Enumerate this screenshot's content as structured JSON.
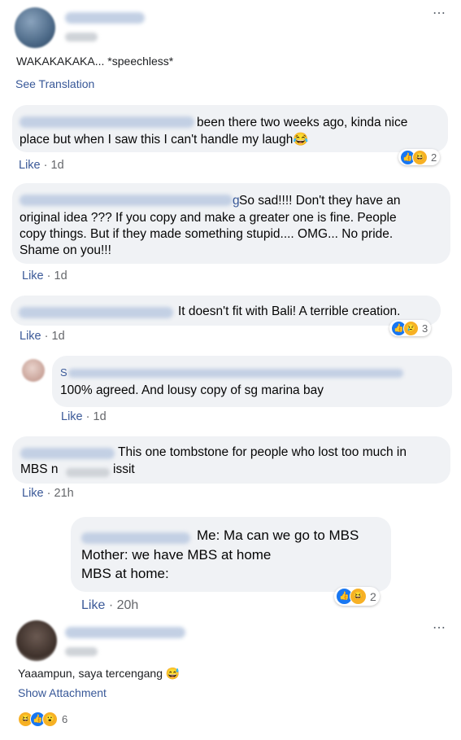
{
  "post1": {
    "text": "WAKAKAKAKA... *speechless*",
    "see_translation": "See Translation",
    "more_icon": "⋯"
  },
  "comments": [
    {
      "text": "been there two weeks ago, kinda nice place but when I saw this I can't handle my laugh😂",
      "line1": "been there two weeks ago, kinda nice",
      "line2": "place but when I saw this I can't handle my laugh😂",
      "like": "Like",
      "time": "1d",
      "reactions": "2"
    },
    {
      "name_tail": "g",
      "line1": " So sad!!!! Don't they have an",
      "line2": "original idea ??? If you copy and make a greater one is fine. People",
      "line3": "copy things. But if they made something stupid.... OMG... No pride.",
      "line4": "Shame on you!!!",
      "like": "Like",
      "time": "1d"
    },
    {
      "line1": "It doesn't fit with Bali! A terrible creation.",
      "like": "Like",
      "time": "1d",
      "reactions": "3"
    },
    {
      "name_head": "S",
      "line1": "100% agreed. And lousy copy of sg marina bay",
      "like": "Like",
      "time": "1d"
    },
    {
      "line1": "This one tombstone for people who lost too much in",
      "line2a": "MBS n",
      "line2b": "issit",
      "like": "Like",
      "time": "21h"
    },
    {
      "line1": "Me: Ma can we go to MBS",
      "line2": "Mother: we have MBS at home",
      "line3": "MBS at home:",
      "like": "Like",
      "time": "20h",
      "reactions": "2"
    }
  ],
  "post2": {
    "text": "Yaaampun, saya tercengang 😅",
    "show_attachment": "Show Attachment",
    "reactions": "6",
    "more_icon": "⋯"
  },
  "separator": "·",
  "colors": {
    "link": "#385898",
    "bubble": "#f0f2f5",
    "like_blue": "#1877f2",
    "emoji_yellow": "#f7b125"
  }
}
